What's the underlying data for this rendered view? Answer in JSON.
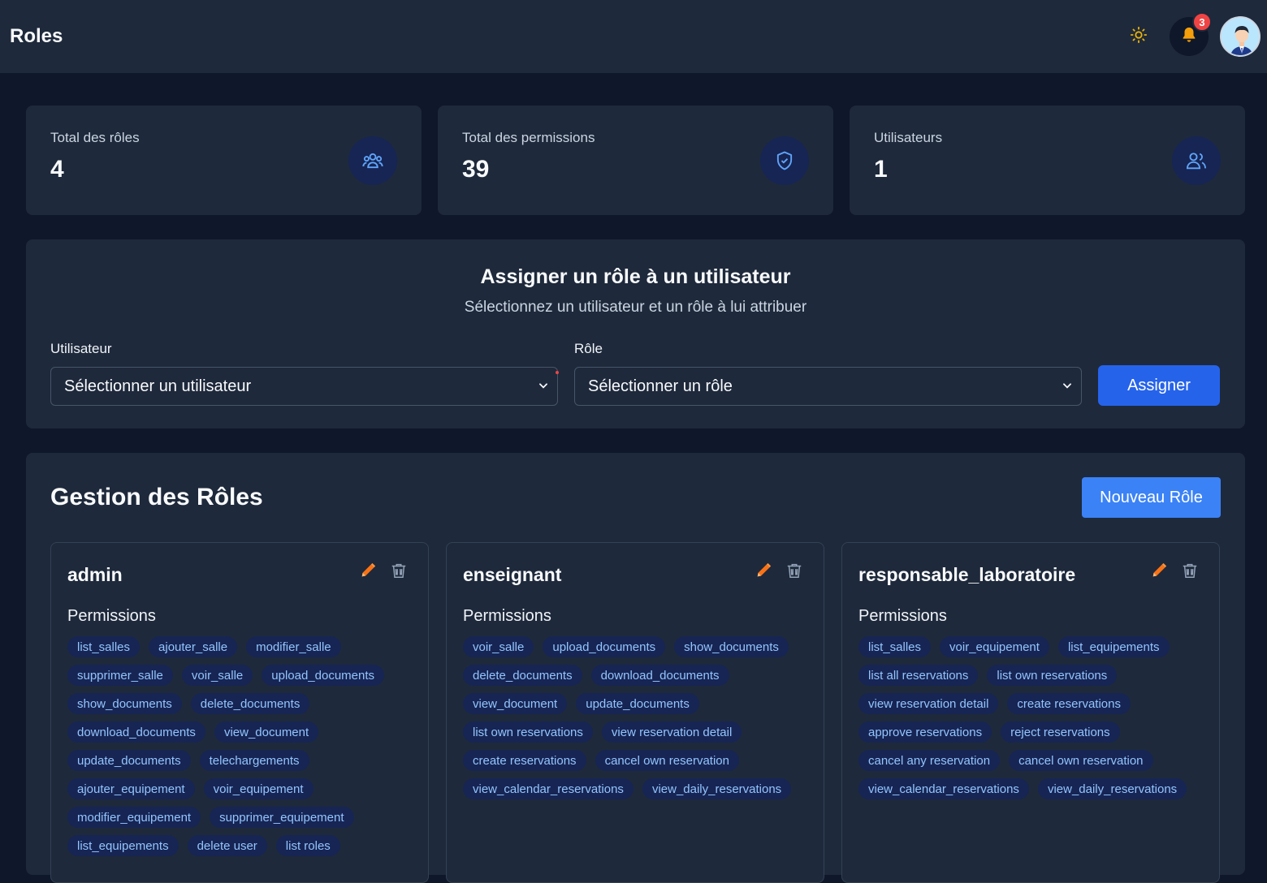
{
  "header": {
    "title": "Roles",
    "notifications_count": "3",
    "theme_icon": "sun-icon",
    "bell_icon": "bell-icon"
  },
  "stats": [
    {
      "label": "Total des rôles",
      "value": "4",
      "icon": "users-group-icon"
    },
    {
      "label": "Total des permissions",
      "value": "39",
      "icon": "shield-check-icon"
    },
    {
      "label": "Utilisateurs",
      "value": "1",
      "icon": "users-icon"
    }
  ],
  "assign": {
    "title": "Assigner un rôle à un utilisateur",
    "subtitle": "Sélectionnez un utilisateur et un rôle à lui attribuer",
    "user_label": "Utilisateur",
    "user_select_value": "Sélectionner un utilisateur",
    "role_label": "Rôle",
    "role_select_value": "Sélectionner un rôle",
    "button_label": "Assigner"
  },
  "roles_section": {
    "title": "Gestion des Rôles",
    "new_button": "Nouveau Rôle",
    "permissions_label": "Permissions",
    "roles": [
      {
        "name": "admin",
        "permissions": [
          "list_salles",
          "ajouter_salle",
          "modifier_salle",
          "supprimer_salle",
          "voir_salle",
          "upload_documents",
          "show_documents",
          "delete_documents",
          "download_documents",
          "view_document",
          "update_documents",
          "telechargements",
          "ajouter_equipement",
          "voir_equipement",
          "modifier_equipement",
          "supprimer_equipement",
          "list_equipements",
          "delete user",
          "list roles"
        ]
      },
      {
        "name": "enseignant",
        "permissions": [
          "voir_salle",
          "upload_documents",
          "show_documents",
          "delete_documents",
          "download_documents",
          "view_document",
          "update_documents",
          "list own reservations",
          "view reservation detail",
          "create reservations",
          "cancel own reservation",
          "view_calendar_reservations",
          "view_daily_reservations"
        ]
      },
      {
        "name": "responsable_laboratoire",
        "permissions": [
          "list_salles",
          "voir_equipement",
          "list_equipements",
          "list all reservations",
          "list own reservations",
          "view reservation detail",
          "create reservations",
          "approve reservations",
          "reject reservations",
          "cancel any reservation",
          "cancel own reservation",
          "view_calendar_reservations",
          "view_daily_reservations"
        ]
      }
    ]
  },
  "colors": {
    "background": "#0f172a",
    "panel": "#1e293b",
    "primary": "#2563eb",
    "chip_bg": "#172554",
    "chip_text": "#93c5fd",
    "badge": "#ef4444"
  }
}
